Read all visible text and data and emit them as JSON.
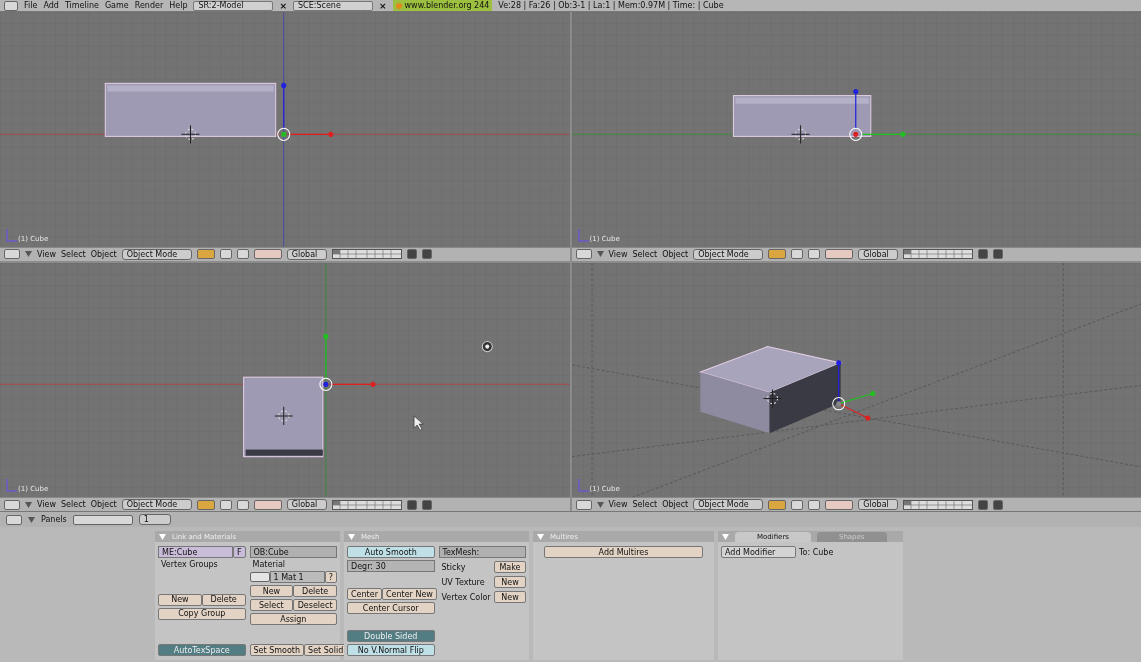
{
  "top_bar": {
    "menus": [
      "File",
      "Add",
      "Timeline",
      "Game",
      "Render",
      "Help"
    ],
    "screen": "SR:2-Model",
    "screen_close": "×",
    "scene": "SCE:Scene",
    "scene_close": "×",
    "version": "www.blender.org 244",
    "stats": "Ve:28 | Fa:26 | Ob:3-1 | La:1 | Mem:0.97M | Time: | Cube"
  },
  "viewports": [
    {
      "kind": "front",
      "label": "(1) Cube",
      "menus": [
        "View",
        "Select",
        "Object"
      ],
      "mode": "Object Mode",
      "orientation": "Global"
    },
    {
      "kind": "side",
      "label": "(1) Cube",
      "menus": [
        "View",
        "Select",
        "Object"
      ],
      "mode": "Object Mode",
      "orientation": "Global"
    },
    {
      "kind": "top",
      "label": "(1) Cube",
      "menus": [
        "View",
        "Select",
        "Object"
      ],
      "mode": "Object Mode",
      "orientation": "Global"
    },
    {
      "kind": "perspective",
      "label": "(1) Cube",
      "menus": [
        "View",
        "Select",
        "Object"
      ],
      "mode": "Object Mode",
      "orientation": "Global"
    }
  ],
  "buttons_header": {
    "menu": "Panels",
    "frame": "1"
  },
  "link_materials": {
    "title": "Link and Materials",
    "mesh_field": "ME:Cube",
    "mesh_flag": "F",
    "object_field": "OB:Cube",
    "vertex_groups_label": "Vertex Groups",
    "vertex_group_buttons": [
      "New",
      "Delete"
    ],
    "copy_group": "Copy Group",
    "autotexspace": {
      "label": "AutoTexSpace",
      "on": true
    },
    "material_label": "Material",
    "material_selector": "1 Mat 1",
    "material_help": "?",
    "material_buttons": [
      "New",
      "Delete",
      "Select",
      "Deselect"
    ],
    "assign": "Assign",
    "smooth_buttons": [
      "Set Smooth",
      "Set Solid"
    ]
  },
  "mesh": {
    "title": "Mesh",
    "auto_smooth": {
      "label": "Auto Smooth",
      "on": false
    },
    "degree": "Degr: 30",
    "texmesh_field": "TexMesh:",
    "rows": [
      {
        "label": "Sticky",
        "button": "Make"
      },
      {
        "label": "UV Texture",
        "button": "New"
      },
      {
        "label": "Vertex Color",
        "button": "New"
      }
    ],
    "center_buttons": [
      "Center",
      "Center New"
    ],
    "center_cursor": "Center Cursor",
    "toggles": [
      {
        "label": "Double Sided",
        "on": true
      },
      {
        "label": "No V.Normal Flip",
        "on": false
      }
    ]
  },
  "multires": {
    "title": "Multires",
    "button": "Add Multires"
  },
  "modifiers": {
    "tabs": [
      {
        "label": "Modifiers",
        "selected": true
      },
      {
        "label": "Shapes",
        "selected": false
      }
    ],
    "button": "Add Modifier",
    "target": "To: Cube"
  }
}
